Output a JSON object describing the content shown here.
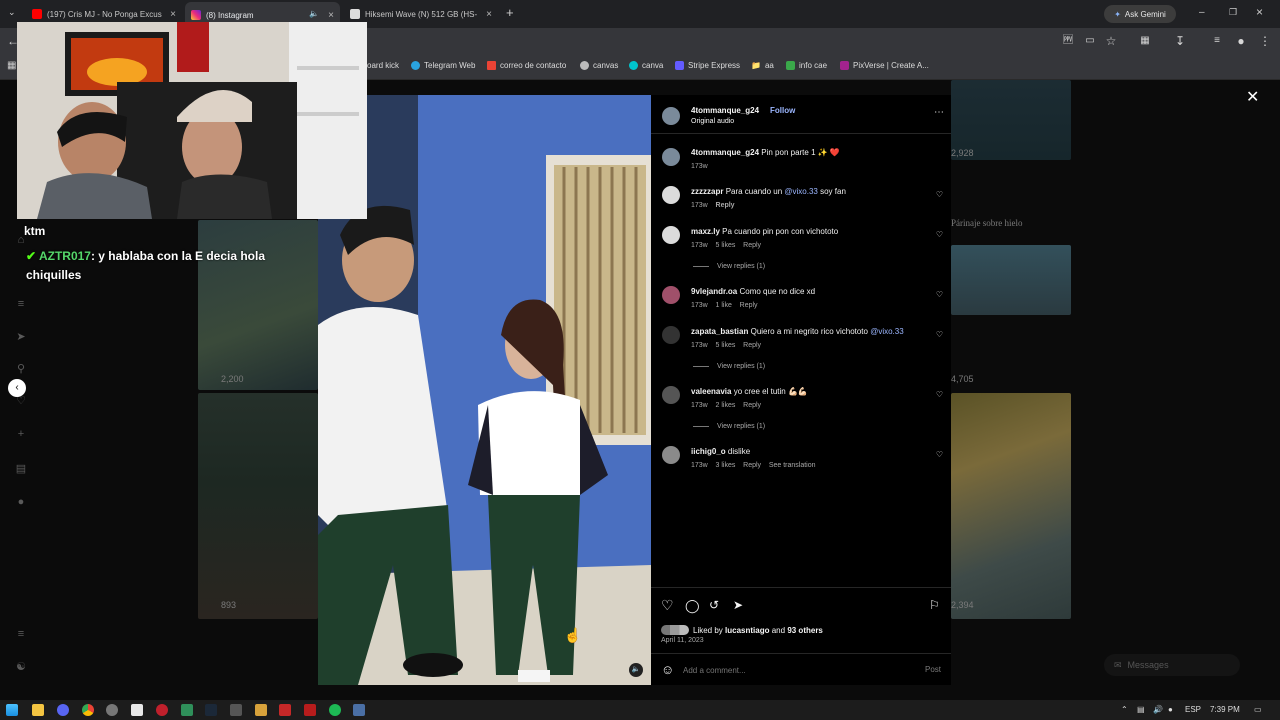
{
  "browser": {
    "tabs": [
      {
        "title": "(197) Cris MJ - No Ponga Excus",
        "icon": "youtube-icon",
        "color": "#ff0000"
      },
      {
        "title": "(8) Instagram",
        "icon": "instagram-icon",
        "color": "#d6249f"
      },
      {
        "title": "Hiksemi Wave (N) 512 GB (HS-",
        "icon": "store-icon",
        "color": "#e0e0e0"
      }
    ],
    "ask_gemini": "Ask Gemini",
    "bookmarks": [
      "oard kick",
      "Telegram Web",
      "correo de contacto",
      "canvas",
      "canva",
      "Stripe Express",
      "aa",
      "info cae",
      "PixVerse | Create A..."
    ]
  },
  "stream_overlay": {
    "chat_user": "ktm",
    "chat_author": "AZTR017",
    "chat_message": ": y hablaba con la E decia hola chiquilles"
  },
  "background_grid": {
    "counts": [
      "2,928",
      "2,200",
      "893",
      "4,705",
      "2,394"
    ],
    "caption": "Párinaje sobre hielo"
  },
  "post": {
    "username": "4tommanque_g24",
    "follow_label": "Follow",
    "audio": "Original audio",
    "caption_user": "4tommanque_g24",
    "caption_text": "Pin pon parte 1 ✨ ❤️",
    "caption_age": "173w",
    "comments": [
      {
        "user": "zzzzzapr",
        "text": "Para cuando un ",
        "mention": "@vixo.33",
        "text_after": " soy fan",
        "age": "173w",
        "likes": "",
        "reply": "Reply",
        "replies": ""
      },
      {
        "user": "maxz.ly",
        "text": "Pa cuando pin pon con vichototo",
        "mention": "",
        "text_after": "",
        "age": "173w",
        "likes": "5 likes",
        "reply": "Reply",
        "replies": "View replies (1)"
      },
      {
        "user": "9vlejandr.oa",
        "text": "Como que no dice xd",
        "mention": "",
        "text_after": "",
        "age": "173w",
        "likes": "1 like",
        "reply": "Reply",
        "replies": ""
      },
      {
        "user": "zapata_bastian",
        "text": "Quiero a mi negrito rico vichototo ",
        "mention": "@vixo.33",
        "text_after": "",
        "age": "173w",
        "likes": "5 likes",
        "reply": "Reply",
        "replies": "View replies (1)"
      },
      {
        "user": "valeenavia",
        "text": "yo cree el tutin 💪🏻💪🏻",
        "mention": "",
        "text_after": "",
        "age": "173w",
        "likes": "2 likes",
        "reply": "Reply",
        "replies": "View replies (1)"
      },
      {
        "user": "iichig0_o",
        "text": "dislike",
        "mention": "",
        "text_after": "",
        "age": "173w",
        "likes": "3 likes",
        "reply": "Reply",
        "translate": "See translation",
        "replies": ""
      }
    ],
    "liked_by_prefix": "Liked by ",
    "liked_by_user": "lucasntiago",
    "liked_by_mid": " and ",
    "liked_by_others": "93 others",
    "date": "April 11, 2023",
    "comment_placeholder": "Add a comment...",
    "post_label": "Post"
  },
  "messages_label": "Messages",
  "taskbar": {
    "lang": "ESP",
    "time": "7:39 PM"
  },
  "colors": {
    "accent": "#0095f6",
    "mention": "#9bb6ff"
  }
}
